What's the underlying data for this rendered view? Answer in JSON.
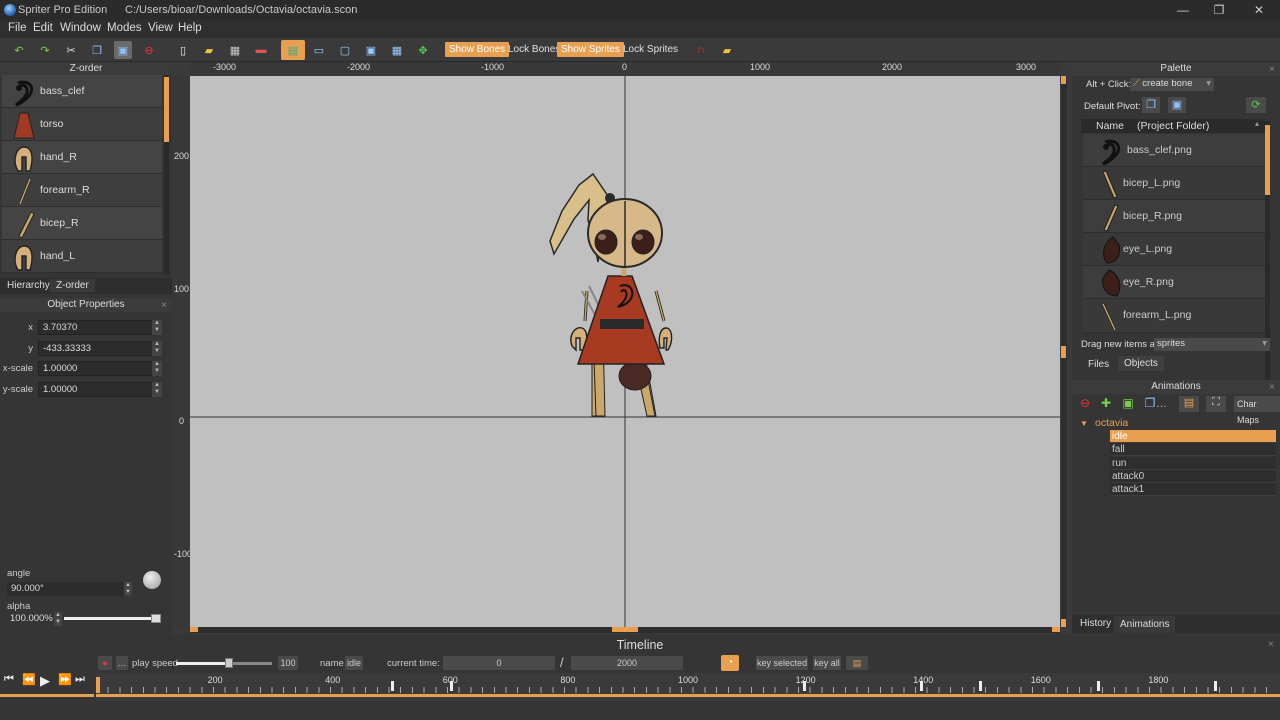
{
  "window": {
    "app_name": "Spriter Pro Edition",
    "file_path": "C:/Users/bioar/Downloads/Octavia/octavia.scon",
    "minimize_icon": "minimize-icon",
    "maximize_icon": "maximize-icon",
    "close_icon": "close-icon"
  },
  "menu": [
    "File",
    "Edit",
    "Window",
    "Modes",
    "View",
    "Help"
  ],
  "toolbar": {
    "show_bones": "Show Bones",
    "lock_bones": "Lock Bones",
    "show_sprites": "Show Sprites",
    "lock_sprites": "Lock Sprites"
  },
  "zorder": {
    "title": "Z-order",
    "items": [
      "bass_clef",
      "torso",
      "hand_R",
      "forearm_R",
      "bicep_R",
      "hand_L"
    ],
    "tabs": [
      "Hierarchy",
      "Z-order"
    ]
  },
  "object_properties": {
    "title": "Object Properties",
    "x_label": "x",
    "x_value": "3.70370",
    "y_label": "y",
    "y_value": "-433.33333",
    "xscale_label": "x-scale",
    "xscale_value": "1.00000",
    "yscale_label": "y-scale",
    "yscale_value": "1.00000",
    "angle_label": "angle",
    "angle_value": "90.000°",
    "alpha_label": "alpha",
    "alpha_value": "100.000%"
  },
  "ruler": {
    "top": [
      "-3000",
      "-2000",
      "-1000",
      "0",
      "1000",
      "2000",
      "3000"
    ],
    "left": [
      "200",
      "100",
      "0",
      "-100"
    ]
  },
  "palette": {
    "title": "Palette",
    "alt_click_label": "Alt + Click:",
    "alt_click_value": "create bone",
    "default_pivot_label": "Default Pivot:",
    "col_name": "Name",
    "col_folder": "(Project Folder)",
    "files": [
      "bass_clef.png",
      "bicep_L.png",
      "bicep_R.png",
      "eye_L.png",
      "eye_R.png",
      "forearm_L.png"
    ],
    "drag_label": "Drag new items as",
    "drag_value": "sprites",
    "tabs": [
      "Files",
      "Objects"
    ]
  },
  "animations": {
    "title": "Animations",
    "char_maps": "Char Maps",
    "entity": "octavia",
    "items": [
      "idle",
      "fall",
      "run",
      "attack0",
      "attack1"
    ],
    "selected_index": 0,
    "tabs": [
      "History",
      "Animations"
    ]
  },
  "timeline": {
    "title": "Timeline",
    "play_speed_label": "play speed",
    "play_speed_value": "100",
    "play_speed_fraction": 0.55,
    "name_label": "name",
    "name_value": "idle",
    "current_time_label": "current time:",
    "current_time_value": "0",
    "separator": "/",
    "total_time_value": "2000",
    "key_selected": "key selected",
    "key_all": "key all",
    "ticks": [
      "200",
      "400",
      "600",
      "800",
      "1000",
      "1200",
      "1400",
      "1600",
      "1800"
    ],
    "duration": 2000,
    "key_times": [
      500,
      600,
      1200,
      1400,
      1500,
      1700,
      1900
    ]
  },
  "colors": {
    "accent": "#e8a050",
    "canvas_bg": "#c0c0c0",
    "panel_bg": "#353535"
  }
}
